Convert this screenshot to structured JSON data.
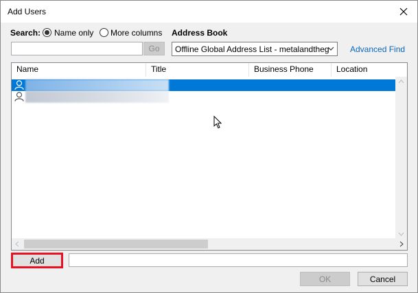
{
  "window": {
    "title": "Add Users"
  },
  "search": {
    "label": "Search:",
    "option_name_only": "Name only",
    "option_more_columns": "More columns",
    "selected": "Name only",
    "input_value": "",
    "go_label": "Go"
  },
  "address_book": {
    "label": "Address Book",
    "selected": "Offline Global Address List - metalandtheg",
    "advanced_find": "Advanced Find"
  },
  "columns": [
    "Name",
    "Title",
    "Business Phone",
    "Location"
  ],
  "rows": [
    {
      "name": "",
      "title": "",
      "phone": "",
      "location": "",
      "selected": true
    },
    {
      "name": "",
      "title": "",
      "phone": "",
      "location": "",
      "selected": false
    }
  ],
  "add_button": "Add",
  "add_field_value": "",
  "ok_label": "OK",
  "cancel_label": "Cancel",
  "colors": {
    "selection": "#0078d7",
    "highlight_border": "#e81123",
    "link": "#0a66b7"
  }
}
